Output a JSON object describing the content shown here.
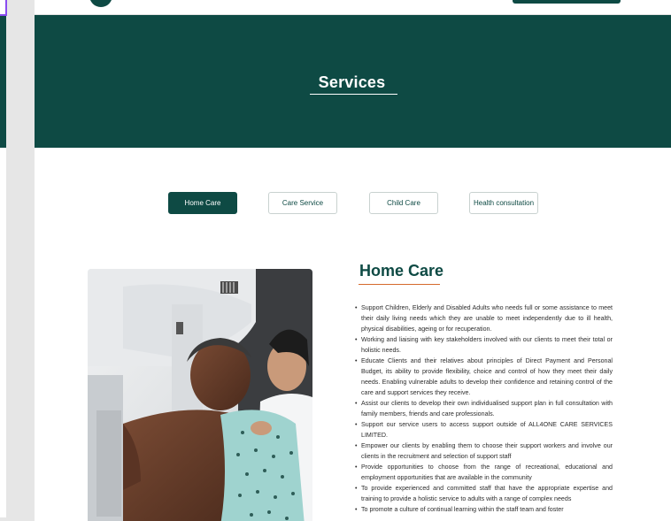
{
  "hero": {
    "title": "Services"
  },
  "tabs": [
    {
      "label": "Home Care",
      "active": true
    },
    {
      "label": "Care Service",
      "active": false
    },
    {
      "label": "Child Care",
      "active": false
    },
    {
      "label": "Health consultation",
      "active": false
    }
  ],
  "content": {
    "title": "Home Care",
    "bullets": [
      "Support Children, Elderly and Disabled Adults who needs full or some assistance to meet their daily living needs which they are unable to meet independently due to ill health, physical disabilities, ageing or for recuperation.",
      "Working and liaising with key stakeholders involved with our clients to meet their total or holistic needs.",
      "Educate Clients and their relatives about principles of Direct Payment and Personal Budget, its ability to provide flexibility, choice and control of how they meet their daily needs. Enabling vulnerable adults to develop their confidence and retaining control of the care and support services they receive.",
      "Assist our clients to develop their own individualised support plan in full consultation with family members, friends and care professionals.",
      "Support our service users to access support outside of ALL4ONE CARE SERVICES LIMITED.",
      "Empower our clients by enabling them to choose their support workers and involve our clients in the recruitment and selection of support staff",
      "Provide opportunities to choose from the range of recreational, educational and employment opportunities that are available in the community",
      "To provide experienced and committed staff that have the appropriate expertise and training to provide a holistic service to adults with a range of complex needs",
      "To promote a culture of continual learning within the staff team and foster"
    ]
  },
  "colors": {
    "brand": "#0e4a44",
    "accent": "#d56a2c",
    "rail": "#e6e6e6"
  }
}
